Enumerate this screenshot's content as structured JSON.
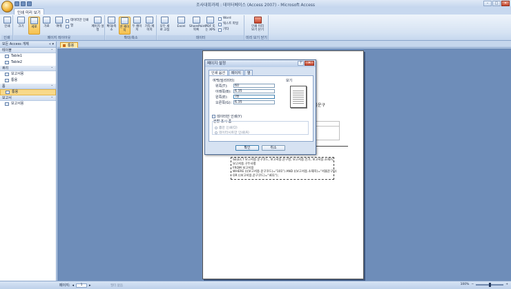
{
  "window": {
    "title": "조사대회과제 : 데이터베이스 (Access 2007) - Microsoft Access",
    "minimize": "–",
    "maximize": "□",
    "close": "✕"
  },
  "ribbon_tab": "인쇄 미리 보기",
  "ribbon": {
    "groups": [
      {
        "label": "인쇄"
      },
      {
        "label": "페이지 레이아웃"
      },
      {
        "label": "확대/축소"
      },
      {
        "label": "데이터"
      },
      {
        "label": "미리 보기 닫기"
      }
    ],
    "print_label": "인쇄",
    "size_label": "크기",
    "portrait_label": "세로",
    "landscape_label": "가로",
    "margins_label": "여백",
    "print_data_only": "데이터만 인쇄",
    "columns_label": "열",
    "page_setup_label": "페이지 설정",
    "zoom_label": "확대/축소",
    "one_page_label": "한 페이지",
    "two_pages_label": "두 페이지",
    "more_pages_label": "기타 페이지",
    "refresh_all_label": "모두 새로 고침",
    "excel_label": "Excel",
    "sharepoint_label": "SharePoint 목록",
    "pdf_label": "PDF 또는 XPS",
    "word_label": "Word",
    "text_file_label": "텍스트 파일",
    "more_label": "기타",
    "close_preview_label": "인쇄 미리 보기 닫기"
  },
  "nav": {
    "header": "모든 Access 개체",
    "sections": [
      {
        "title": "테이블",
        "items": [
          "Table1",
          "Table2"
        ]
      },
      {
        "title": "쿼리",
        "items": [
          "보고서용",
          "통용"
        ]
      },
      {
        "title": "폼",
        "items": [
          "통용"
        ]
      },
      {
        "title": "보고서",
        "items": [
          "보고서용"
        ]
      }
    ]
  },
  "document": {
    "tab": "통용",
    "page_text": {
      "right_fragment": "서울운구",
      "small_label": "반"
    },
    "sql_lines": [
      "SELECT 보고서용.운구코드, 보고서용.운구명, 보고서용.인가, 보고서용.소재지,",
      "보고서용.구두사항",
      "FROM 보고서용",
      "WHERE (((보고서용.운구코드)=\"101\") AND ((보고서용.소재지)=\"서울운구\"))",
      "OR ((보고서용.운구코드)=\"401\");"
    ]
  },
  "dialog": {
    "title": "페이지 설정",
    "help": "?",
    "close": "✕",
    "tabs": [
      "인쇄 옵션",
      "페이지",
      "열"
    ],
    "margins_group": "여백(밀리미터)",
    "fields": [
      {
        "label": "위쪽(T):",
        "value": "60"
      },
      {
        "label": "아래쪽(B):",
        "value": "6.35"
      },
      {
        "label": "왼쪽(E):",
        "value": "78"
      },
      {
        "label": "오른쪽(G):",
        "value": "6.35"
      }
    ],
    "preview_label": "보기",
    "print_data_only": "데이터만 인쇄(Y)",
    "split_form_label": "분할 표시 폼",
    "radio_form_only": "폼만 인쇄(Q)",
    "radio_datasheet_only": "데이터시트만 인쇄(A)",
    "ok": "확인",
    "cancel": "취소"
  },
  "statusbar": {
    "page_label": "페이지:",
    "page_value": "1",
    "filter_label": "필터 없음",
    "zoom_value": "100%"
  }
}
